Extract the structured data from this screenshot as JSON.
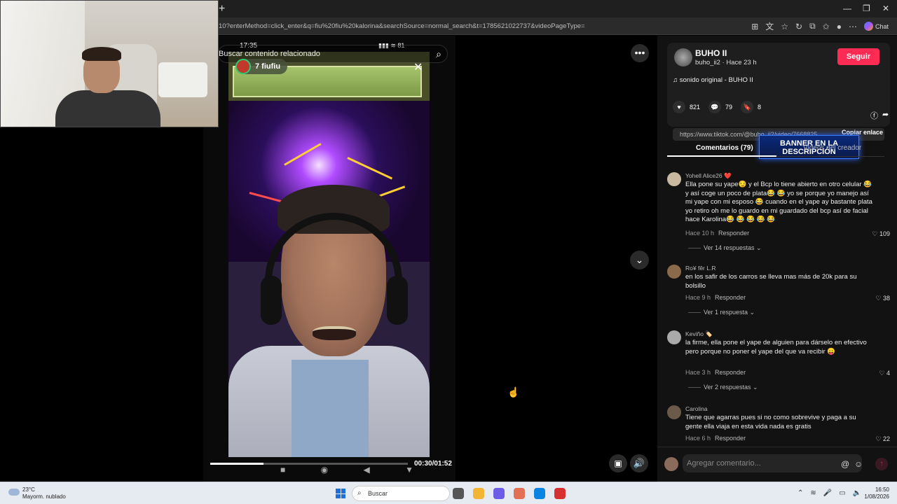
{
  "browser": {
    "new_tab_label": "+",
    "url": "10?enterMethod=click_enter&q=fiu%20fiu%20kalorina&searchSource=normal_search&t=1785621022737&videoPageType=",
    "chat_label": "Chat",
    "window_controls": [
      "—",
      "❐",
      "✕"
    ]
  },
  "video": {
    "search_related_label": "Buscar contenido relacionado",
    "status_time": "17:35",
    "status_right": "▮▮▮ ≋ 81",
    "live_badge": "7 fiufiu",
    "close_icon": "✕",
    "progress": 0.27,
    "time": "00:30/01:52"
  },
  "panel": {
    "author_name": "BUHO II",
    "author_meta": "buho_ii2 · Hace 23 h",
    "follow_label": "Seguir",
    "sound": "♫  sonido original - BUHO II",
    "likes": "821",
    "comments_count": "79",
    "saves": "8",
    "banner": "BANNER EN LA DESCRIPCIÓN",
    "link": "https://www.tiktok.com/@buho_ii2/video/7668825...",
    "copy_label": "Copiar enlace",
    "tab_comments": "Comentarios (79)",
    "tab_creator": "Videos del creador"
  },
  "comments": [
    {
      "user": "Yohell Alice26 ❤️",
      "text": "Ella pone su yape😏 y el Bcp lo tiene abierto en otro celular 😂y así coge un poco de plata😂 😂 yo se porque yo manejo así mi yape con mi esposo 😂 cuando en el yape ay bastante plata yo retiro oh me lo guardo en mi guardado del bcp así de facial hace Karolina😂 😂 😂 😂 😂",
      "time": "Hace 10 h",
      "reply": "Responder",
      "likes": "♡ 109",
      "more": "Ver 14 respuestas ⌄"
    },
    {
      "user": "Ro¥ fêr L.R",
      "text": "en los safir de los carros se lleva mas más de 20k para su bolsillo",
      "time": "Hace 9 h",
      "reply": "Responder",
      "likes": "♡ 38",
      "more": "Ver 1 respuesta ⌄"
    },
    {
      "user": "Keviño 🏷️",
      "text": "la firme, ella pone el yape de alguien para dárselo en efectivo pero porque no poner el yape del que va recibir 😛",
      "time": "Hace 3 h",
      "reply": "Responder",
      "likes": "♡ 4",
      "more": "Ver 2 respuestas ⌄"
    },
    {
      "user": "Carolina",
      "text": "Tiene que agarras pues si no como sobrevive y paga a su gente ella viaja en esta vida nada es gratis",
      "time": "Hace 6 h",
      "reply": "Responder",
      "likes": "♡ 22",
      "more": ""
    }
  ],
  "comment_input": {
    "placeholder": "Agregar comentario...",
    "at_icon": "@",
    "emoji_icon": "☺",
    "send_icon": "↑"
  },
  "taskbar": {
    "weather_temp": "23°C",
    "weather_desc": "Mayorm. nublado",
    "search_label": "Buscar",
    "clock_time": "16:50",
    "clock_date": "1/08/2026",
    "app_colors": [
      "#555",
      "#f2b632",
      "#6c5ce7",
      "#e17055",
      "#0984e3",
      "#d63031"
    ]
  }
}
